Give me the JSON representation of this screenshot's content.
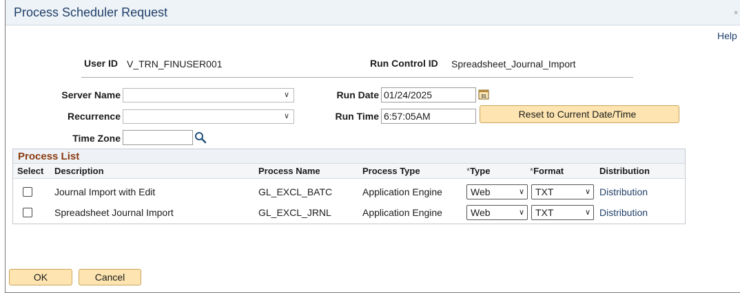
{
  "window": {
    "title": "Process Scheduler Request",
    "close_glyph": "×",
    "help_label": "Help"
  },
  "info": {
    "user_id_label": "User ID",
    "user_id_value": "V_TRN_FINUSER001",
    "run_control_label": "Run Control ID",
    "run_control_value": "Spreadsheet_Journal_Import"
  },
  "form": {
    "server_name_label": "Server Name",
    "server_name_value": "",
    "recurrence_label": "Recurrence",
    "recurrence_value": "",
    "time_zone_label": "Time Zone",
    "time_zone_value": "",
    "run_date_label": "Run Date",
    "run_date_value": "01/24/2025",
    "run_time_label": "Run Time",
    "run_time_value": "6:57:05AM",
    "reset_button_label": "Reset to Current Date/Time",
    "calendar_icon": "calendar-icon",
    "search_icon": "search-icon"
  },
  "process_list": {
    "title": "Process List",
    "columns": {
      "select": "Select",
      "description": "Description",
      "process_name": "Process Name",
      "process_type": "Process Type",
      "type_required": "*",
      "type": "Type",
      "format_required": "*",
      "format": "Format",
      "distribution": "Distribution"
    },
    "rows": [
      {
        "selected": false,
        "description": "Journal Import with Edit",
        "process_name": "GL_EXCL_BATC",
        "process_type": "Application Engine",
        "type": "Web",
        "format": "TXT",
        "distribution": "Distribution"
      },
      {
        "selected": false,
        "description": "Spreadsheet Journal Import",
        "process_name": "GL_EXCL_JRNL",
        "process_type": "Application Engine",
        "type": "Web",
        "format": "TXT",
        "distribution": "Distribution"
      }
    ]
  },
  "footer": {
    "ok_label": "OK",
    "cancel_label": "Cancel"
  },
  "colors": {
    "title_text": "#1f3f68",
    "button_bg": "#fde4b0",
    "grid_title": "#8b3a0f"
  }
}
